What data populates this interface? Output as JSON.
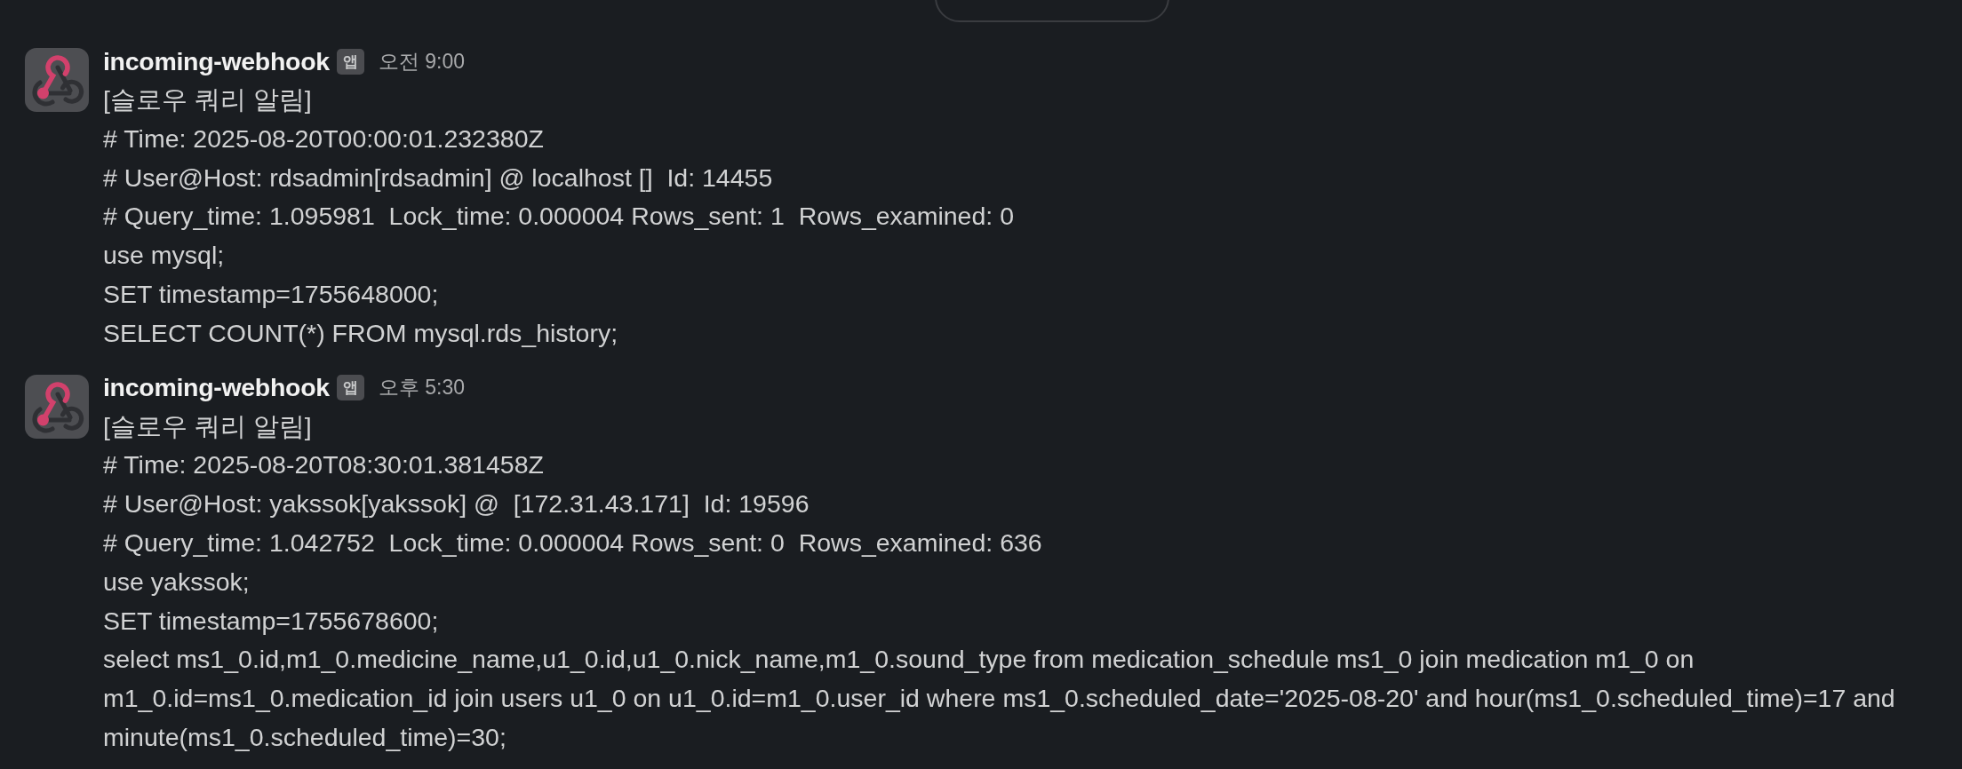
{
  "messages": [
    {
      "sender": "incoming-webhook",
      "badge": "앱",
      "time": "오전 9:00",
      "lines": [
        "[슬로우 쿼리 알림]",
        "# Time: 2025-08-20T00:00:01.232380Z",
        "# User@Host: rdsadmin[rdsadmin] @ localhost []  Id: 14455",
        "# Query_time: 1.095981  Lock_time: 0.000004 Rows_sent: 1  Rows_examined: 0",
        "use mysql;",
        "SET timestamp=1755648000;",
        "SELECT COUNT(*) FROM mysql.rds_history;"
      ]
    },
    {
      "sender": "incoming-webhook",
      "badge": "앱",
      "time": "오후 5:30",
      "lines": [
        "[슬로우 쿼리 알림]",
        "# Time: 2025-08-20T08:30:01.381458Z",
        "# User@Host: yakssok[yakssok] @  [172.31.43.171]  Id: 19596",
        "# Query_time: 1.042752  Lock_time: 0.000004 Rows_sent: 0  Rows_examined: 636",
        "use yakssok;",
        "SET timestamp=1755678600;",
        "select ms1_0.id,m1_0.medicine_name,u1_0.id,u1_0.nick_name,m1_0.sound_type from medication_schedule ms1_0 join medication m1_0 on m1_0.id=ms1_0.medication_id join users u1_0 on u1_0.id=m1_0.user_id where ms1_0.scheduled_date='2025-08-20' and hour(ms1_0.scheduled_time)=17 and minute(ms1_0.scheduled_time)=30;"
      ]
    }
  ]
}
